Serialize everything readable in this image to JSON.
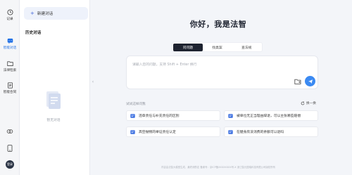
{
  "rail": {
    "items": [
      {
        "label": "记录",
        "icon": "clock-icon"
      },
      {
        "label": "智能对话",
        "icon": "chat-icon"
      },
      {
        "label": "法律检索",
        "icon": "folder-icon"
      },
      {
        "label": "智能合同",
        "icon": "document-icon"
      }
    ],
    "avatar_text": "登录"
  },
  "sidebar": {
    "new_chat_label": "新建对话",
    "history_title": "历史对话",
    "empty_text": "暂无对话"
  },
  "main": {
    "title": "你好，我是法智",
    "tabs": [
      {
        "label": "问问题",
        "active": true
      },
      {
        "label": "找类案",
        "active": false
      },
      {
        "label": "查法规",
        "active": false
      }
    ],
    "input_placeholder": "请输入您的问题，支持 Shift + Enter 换行",
    "suggest_title": "试试这样问我",
    "refresh_label": "换一换",
    "suggestions": [
      "违章责任与补充责任的区别",
      "被单位无正当理由辞退，可以主张哪些赔偿",
      "高空抛物的举证责任认定",
      "在健身房没消费的余额可以退吗"
    ],
    "footer": "内容由法智大模型生成，最终请酌定  备案号：京ICP备XXXXXXXX号-X  浙江智元国瑞科技有限公司版权所有"
  },
  "colors": {
    "accent": "#3b8af2",
    "tab_active": "#1e2330",
    "background": "#f3f5f9"
  }
}
